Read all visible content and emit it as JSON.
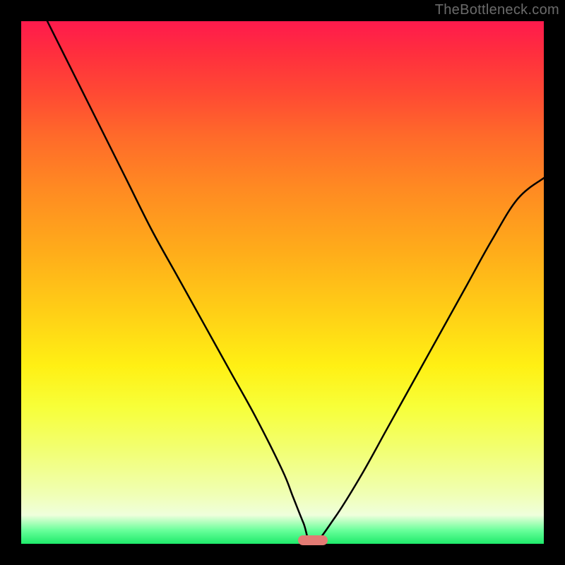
{
  "watermark": "TheBottleneck.com",
  "colors": {
    "page_bg": "#000000",
    "marker": "#e37b74",
    "curve": "#000000"
  },
  "chart_data": {
    "type": "line",
    "title": "",
    "xlabel": "",
    "ylabel": "",
    "xlim": [
      0,
      100
    ],
    "ylim": [
      0,
      100
    ],
    "series": [
      {
        "name": "bottleneck-curve",
        "x": [
          5,
          10,
          15,
          20,
          25,
          30,
          35,
          40,
          45,
          50,
          52,
          54,
          55.8,
          60,
          65,
          70,
          75,
          80,
          85,
          90,
          95,
          100
        ],
        "values": [
          100,
          90,
          80,
          70,
          60,
          51,
          42,
          33,
          24,
          14,
          9,
          4,
          0,
          5,
          13,
          22,
          31,
          40,
          49,
          58,
          66,
          70
        ]
      }
    ],
    "annotations": [
      {
        "name": "minimum-marker",
        "x": 55.8,
        "y": 0
      }
    ],
    "background_gradient": {
      "top": "#ff1a4d",
      "mid": "#fff014",
      "bottom": "#1eea6a"
    }
  }
}
